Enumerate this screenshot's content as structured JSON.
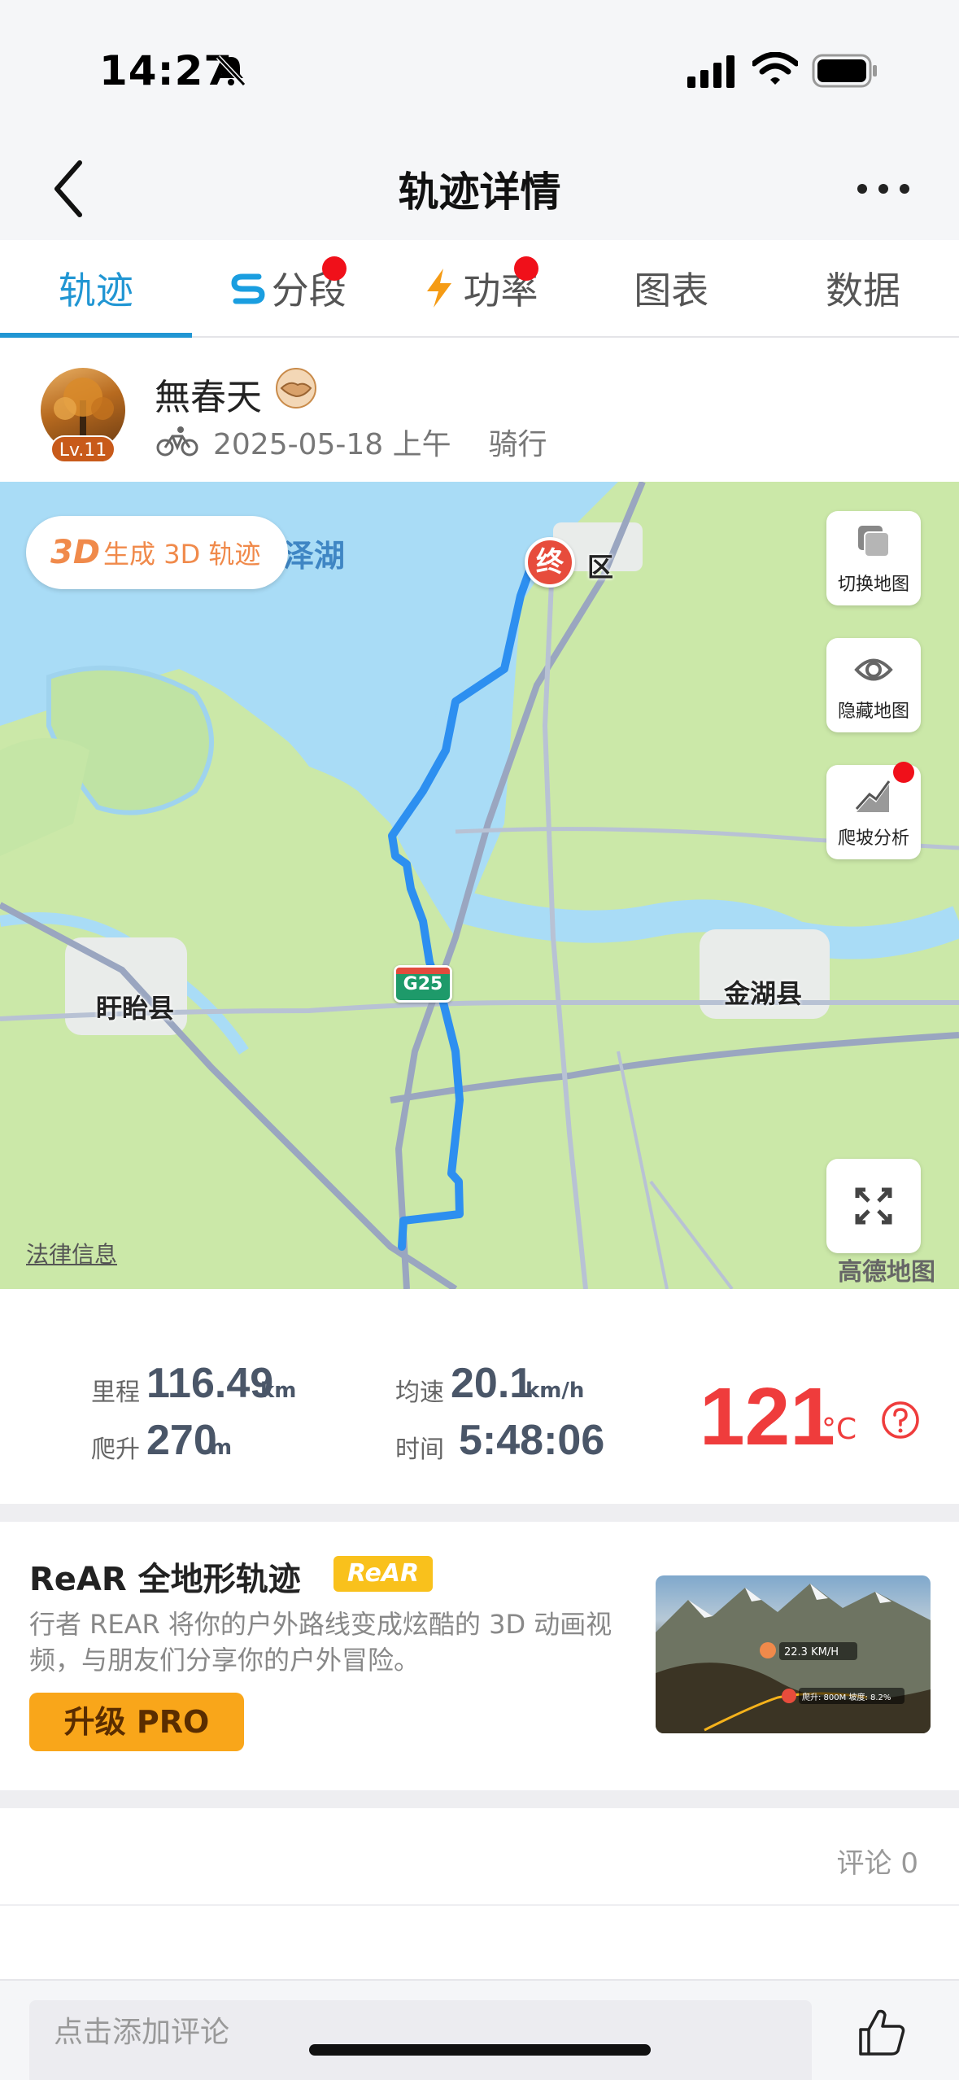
{
  "status_bar": {
    "time": "14:27",
    "icons": [
      "bell-muted-icon",
      "signal-icon",
      "wifi-icon",
      "battery-icon"
    ]
  },
  "header": {
    "title": "轨迹详情",
    "back_icon": "chevron-left-icon",
    "more_icon": "more-dots-icon"
  },
  "tabs": [
    {
      "label": "轨迹",
      "active": true
    },
    {
      "label": "分段",
      "icon": "segment-icon",
      "badge_dot": true
    },
    {
      "label": "功率",
      "icon": "lightning-icon",
      "badge_dot": true
    },
    {
      "label": "图表"
    },
    {
      "label": "数据"
    }
  ],
  "user": {
    "name": "無春天",
    "level": "Lv.11",
    "date": "2025-05-18 上午",
    "activity": "骑行"
  },
  "map": {
    "btn_3d_tag": "3D",
    "btn_3d_text": "生成 3D 轨迹",
    "lake_label": "泽湖",
    "district_label": "区",
    "end_marker": "终",
    "highway": "G25",
    "places": [
      "盱眙县",
      "金湖县"
    ],
    "tools": [
      {
        "label": "切换地图",
        "icon": "layers-icon"
      },
      {
        "label": "隐藏地图",
        "icon": "eye-icon"
      },
      {
        "label": "爬坡分析",
        "icon": "climb-icon",
        "badge_dot": true
      }
    ],
    "fullscreen_icon": "fullscreen-icon",
    "legal": "法律信息",
    "provider": "高德地图",
    "colors": {
      "water": "#a9dcf6",
      "land": "#cbe8a8",
      "route": "#2d8ff0"
    }
  },
  "stats": {
    "distance": {
      "label": "里程",
      "value": "116.49",
      "unit": "km"
    },
    "avg_speed": {
      "label": "均速",
      "value": "20.1",
      "unit": "km/h"
    },
    "climb": {
      "label": "爬升",
      "value": "270",
      "unit": "m"
    },
    "time": {
      "label": "时间",
      "value": "5:48:06"
    },
    "temperature": {
      "value": "121",
      "unit": "°C"
    }
  },
  "promo": {
    "title": "ReAR 全地形轨迹",
    "badge": "ReAR",
    "description": "行者 REAR 将你的户外路线变成炫酷的 3D 动画视频，与朋友们分享你的户外冒险。",
    "button": "升级 PRO",
    "image_speed": "22.3 KM/H",
    "image_stats": "爬升: 800M 坡度: 8.2%"
  },
  "comments": {
    "count_label": "评论 0",
    "placeholder": "点击添加评论"
  }
}
